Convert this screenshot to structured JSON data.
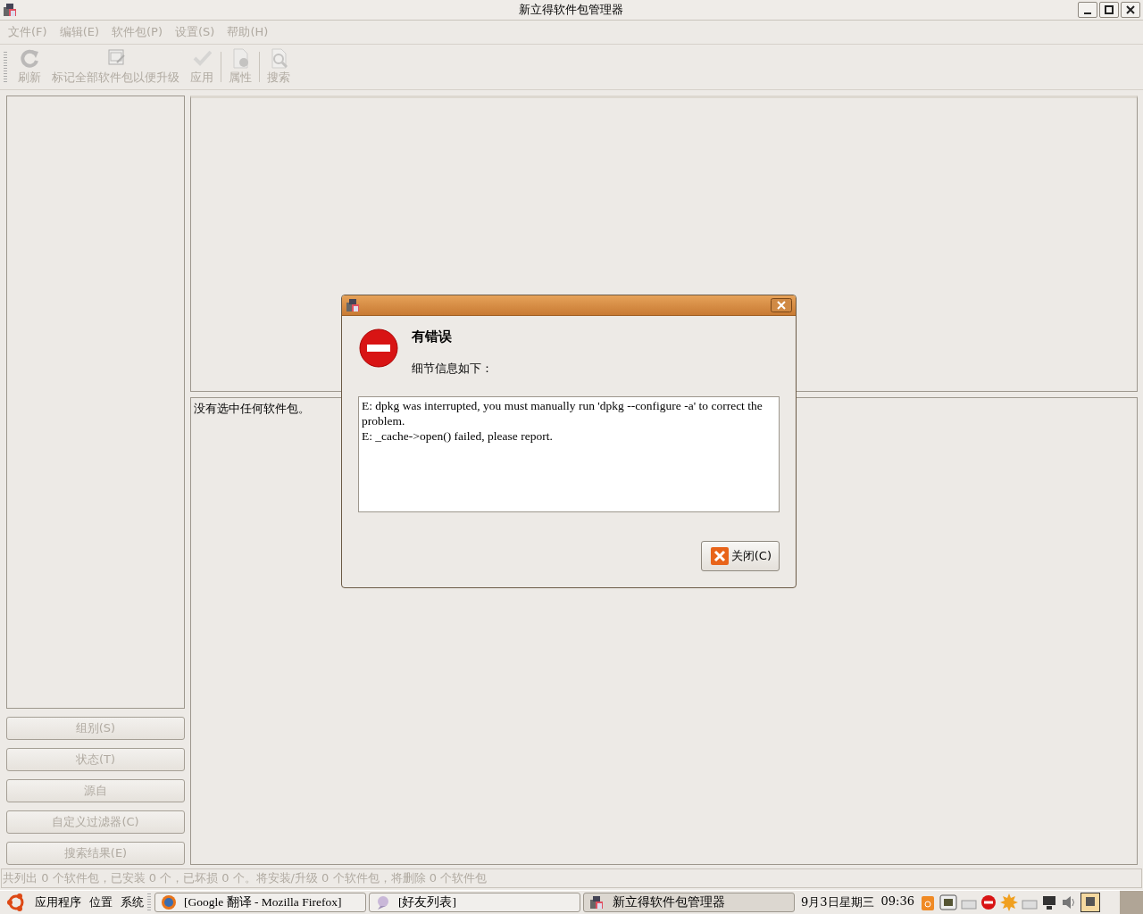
{
  "window": {
    "title": "新立得软件包管理器"
  },
  "menu": [
    {
      "label": "文件(F)",
      "disabled": true
    },
    {
      "label": "编辑(E)",
      "disabled": true
    },
    {
      "label": "软件包(P)",
      "disabled": true
    },
    {
      "label": "设置(S)",
      "disabled": true
    },
    {
      "label": "帮助(H)",
      "disabled": true
    }
  ],
  "toolbar": [
    {
      "kind": "refresh",
      "label": "刷新",
      "disabled": true
    },
    {
      "kind": "mark",
      "label": "标记全部软件包以便升级",
      "disabled": true
    },
    {
      "kind": "apply",
      "label": "应用",
      "disabled": true
    },
    {
      "kind": "separator"
    },
    {
      "kind": "properties",
      "label": "属性",
      "disabled": true
    },
    {
      "kind": "separator"
    },
    {
      "kind": "search",
      "label": "搜索",
      "disabled": true
    }
  ],
  "filters": [
    {
      "label": "组别(S)",
      "disabled": true
    },
    {
      "label": "状态(T)",
      "disabled": true
    },
    {
      "label": "源自",
      "disabled": true
    },
    {
      "label": "自定义过滤器(C)",
      "disabled": true
    },
    {
      "label": "搜索结果(E)",
      "disabled": true
    }
  ],
  "details": {
    "text": "没有选中任何软件包。"
  },
  "status_bar": {
    "text": "共列出 0 个软件包，已安装 0 个，已坏损 0 个。将安装/升级 0 个软件包，将删除 0 个软件包",
    "disabled": true
  },
  "dialog": {
    "heading": "有错误",
    "subheading": "细节信息如下：",
    "log": [
      "E: dpkg was interrupted, you must manually run 'dpkg --configure -a' to correct the problem.",
      "E: _cache->open() failed, please report."
    ],
    "close_button": "关闭(C)"
  },
  "taskbar": {
    "menus": [
      "应用程序",
      "位置",
      "系统"
    ],
    "tasks": [
      {
        "kind": "browser",
        "label": "[Google 翻译  - Mozilla Firefox]",
        "selected": false
      },
      {
        "kind": "chat",
        "label": "[好友列表]",
        "selected": false
      },
      {
        "kind": "package",
        "label": "新立得软件包管理器",
        "selected": true
      }
    ],
    "date": "9月3日星期三",
    "time": "09:36"
  }
}
